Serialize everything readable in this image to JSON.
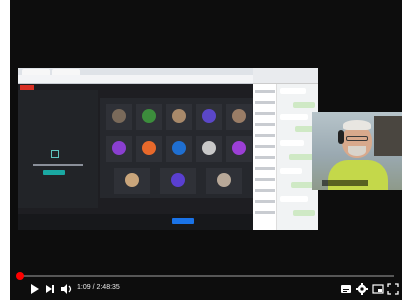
{
  "player": {
    "time_display": "1:09 / 2:48:35",
    "progress_fraction": 0.005,
    "controls": {
      "left": [
        "play-icon",
        "next-icon",
        "volume-icon"
      ],
      "right": [
        "subtitles-icon",
        "settings-icon",
        "miniplayer-icon",
        "fullscreen-icon"
      ]
    },
    "colors": {
      "progress": "#ff0000",
      "background": "#0d0d0d"
    }
  },
  "screen_share": {
    "meeting_tiles": [
      {
        "color": "#7a6a5a"
      },
      {
        "color": "#3c8d3c"
      },
      {
        "color": "#a8896a"
      },
      {
        "color": "#5b47c8"
      },
      {
        "color": "#9a7d66"
      },
      {
        "color": "#8a3fd0"
      },
      {
        "color": "#e8692b"
      },
      {
        "color": "#1f6fd1"
      },
      {
        "color": "#c8c8c8"
      },
      {
        "color": "#9c3fd6"
      },
      {
        "color": "#c9a57b"
      },
      {
        "color": "#5a3fd0"
      },
      {
        "color": "#b8a898"
      }
    ],
    "colors": {
      "accent": "#1aa8a2",
      "record": "#d93025",
      "join": "#1a73e8"
    }
  },
  "webcam": {
    "colors": {
      "shirt": "#c4d84a"
    }
  }
}
